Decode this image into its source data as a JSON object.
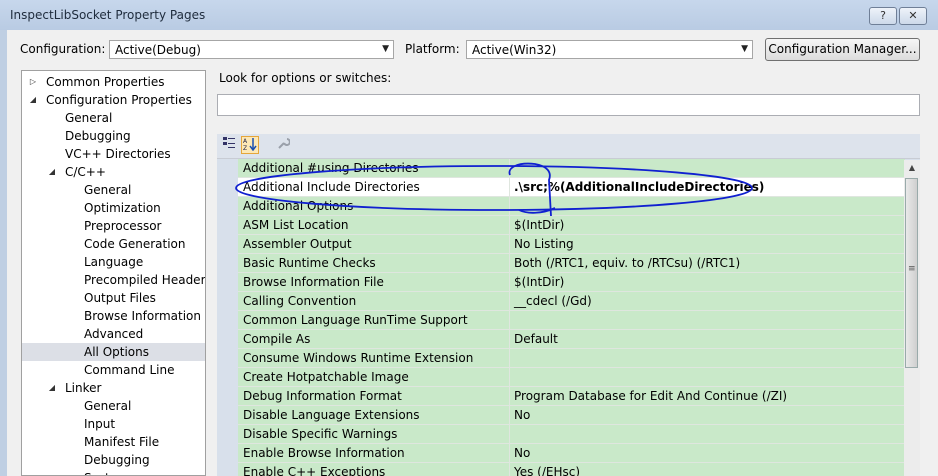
{
  "window": {
    "title": "InspectLibSocket Property Pages",
    "help_label": "?",
    "close_label": "✕"
  },
  "toolbar": {
    "configuration_label": "Configuration:",
    "configuration_value": "Active(Debug)",
    "platform_label": "Platform:",
    "platform_value": "Active(Win32)",
    "config_manager_label": "Configuration Manager..."
  },
  "tree": {
    "items": [
      {
        "label": "Common Properties",
        "expander": "▷"
      },
      {
        "label": "Configuration Properties",
        "expander": "◢"
      },
      {
        "label": "General"
      },
      {
        "label": "Debugging"
      },
      {
        "label": "VC++ Directories"
      },
      {
        "label": "C/C++",
        "expander": "◢"
      },
      {
        "label": "General"
      },
      {
        "label": "Optimization"
      },
      {
        "label": "Preprocessor"
      },
      {
        "label": "Code Generation"
      },
      {
        "label": "Language"
      },
      {
        "label": "Precompiled Headers"
      },
      {
        "label": "Output Files"
      },
      {
        "label": "Browse Information"
      },
      {
        "label": "Advanced"
      },
      {
        "label": "All Options",
        "selected": true
      },
      {
        "label": "Command Line"
      },
      {
        "label": "Linker",
        "expander": "◢"
      },
      {
        "label": "General"
      },
      {
        "label": "Input"
      },
      {
        "label": "Manifest File"
      },
      {
        "label": "Debugging"
      },
      {
        "label": "System"
      }
    ]
  },
  "search": {
    "label": "Look for options or switches:",
    "value": ""
  },
  "grid_toolbar": {
    "categorized_icon": "categorized-view-icon",
    "alphabetical_icon": "alphabetical-sort-icon",
    "property_pages_icon": "wrench-icon"
  },
  "grid": {
    "rows": [
      {
        "name": "Additional #using Directories",
        "value": ""
      },
      {
        "name": "Additional Include Directories",
        "value": ".\\src;%(AdditionalIncludeDirectories)",
        "selected": true
      },
      {
        "name": "Additional Options",
        "value": ""
      },
      {
        "name": "ASM List Location",
        "value": "$(IntDir)"
      },
      {
        "name": "Assembler Output",
        "value": "No Listing"
      },
      {
        "name": "Basic Runtime Checks",
        "value": "Both (/RTC1, equiv. to /RTCsu) (/RTC1)"
      },
      {
        "name": "Browse Information File",
        "value": "$(IntDir)"
      },
      {
        "name": "Calling Convention",
        "value": "__cdecl (/Gd)"
      },
      {
        "name": "Common Language RunTime Support",
        "value": ""
      },
      {
        "name": "Compile As",
        "value": "Default"
      },
      {
        "name": "Consume Windows Runtime Extension",
        "value": ""
      },
      {
        "name": "Create Hotpatchable Image",
        "value": ""
      },
      {
        "name": "Debug Information Format",
        "value": "Program Database for Edit And Continue (/ZI)"
      },
      {
        "name": "Disable Language Extensions",
        "value": "No"
      },
      {
        "name": "Disable Specific Warnings",
        "value": ""
      },
      {
        "name": "Enable Browse Information",
        "value": "No"
      },
      {
        "name": "Enable C++ Exceptions",
        "value": "Yes (/EHsc)"
      }
    ]
  },
  "colors": {
    "row_background": "#c9e9c9",
    "annotation": "#1020d0"
  }
}
